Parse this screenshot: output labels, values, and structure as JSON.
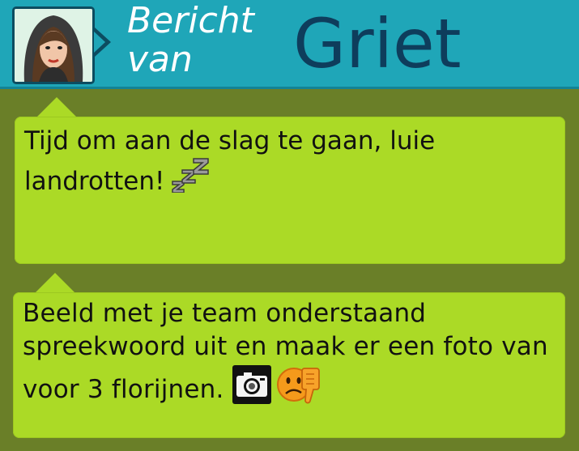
{
  "header": {
    "title_prefix": "Bericht van",
    "sender": "Griet",
    "avatar": "avatar-griet"
  },
  "messages": [
    {
      "text": "Tijd om aan de slag te gaan, luie landrotten!",
      "icons": [
        "zzz-icon"
      ]
    },
    {
      "text": "Beeld met je team onderstaand spreekwoord uit en maak er een foto van voor 3 florijnen.",
      "icons": [
        "camera-icon",
        "thumbs-down-emoji-icon"
      ]
    }
  ],
  "colors": {
    "header_bg": "#1fa6b8",
    "sender_text": "#0e3d5c",
    "bubble_bg": "#abda26",
    "page_bg": "#6a7f28"
  }
}
